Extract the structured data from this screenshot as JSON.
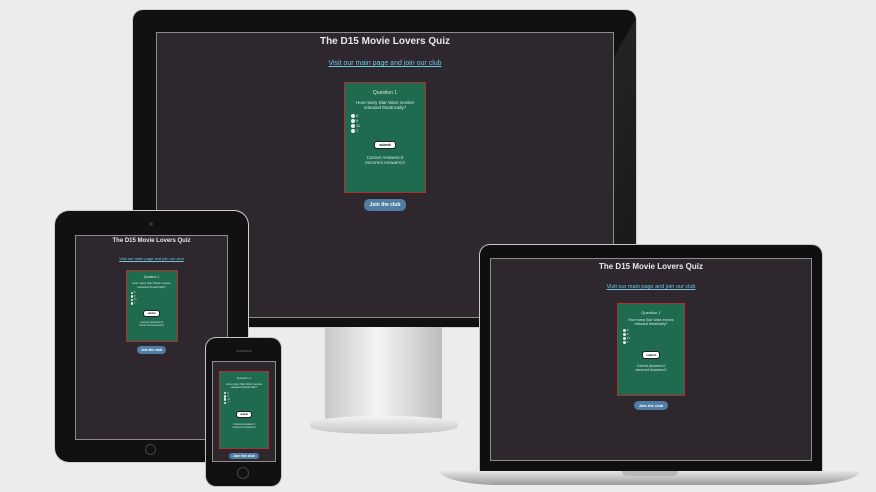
{
  "site": {
    "title": "The D15 Movie Lovers Quiz",
    "link": "Visit our main page and join our club",
    "club_button": "Join the club"
  },
  "quiz": {
    "heading": "Question 1",
    "question": "How many Star Wars movies released theatrically?",
    "options": [
      "6",
      "9",
      "11",
      "7"
    ],
    "submit": "submit",
    "correct": "Correct Answers:0",
    "incorrect": "Incorrect Answers:0"
  },
  "colors": {
    "background": "#2e272e",
    "quiz_card": "#1f6b4f",
    "quiz_border": "#b03030",
    "link": "#6fc8e0",
    "club_button": "#4f7da3"
  }
}
